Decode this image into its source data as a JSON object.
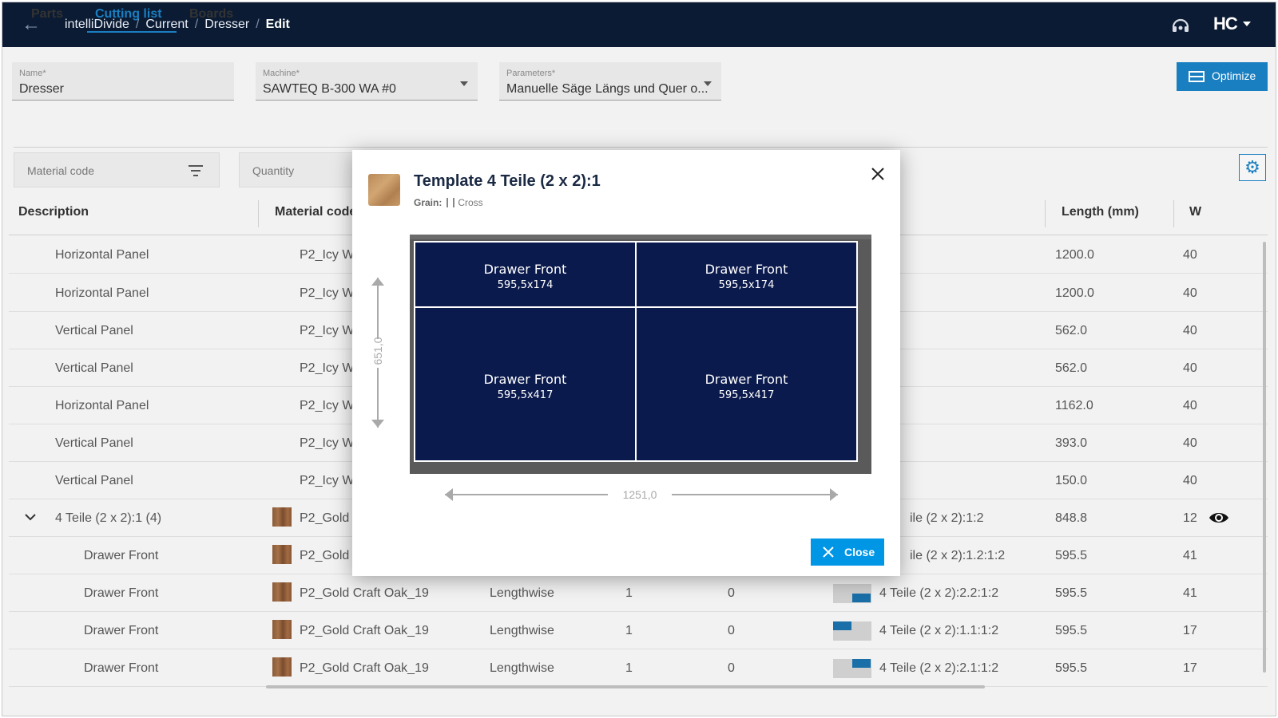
{
  "topbar": {
    "breadcrumbs": [
      "intelliDivide",
      "Current",
      "Dresser",
      "Edit"
    ],
    "brand": "HC"
  },
  "form": {
    "name": {
      "label": "Name*",
      "value": "Dresser"
    },
    "machine": {
      "label": "Machine*",
      "value": "SAWTEQ B-300 WA #0"
    },
    "parameters": {
      "label": "Parameters*",
      "value": "Manuelle Säge Längs und Quer o..."
    },
    "optimize_label": "Optimize"
  },
  "tabs": [
    "Parts",
    "Cutting list",
    "Boards"
  ],
  "active_tab": "Cutting list",
  "filters": {
    "material_code": "Material code",
    "quantity": "Quantity"
  },
  "table": {
    "headers": {
      "description": "Description",
      "material_code": "Material code",
      "length": "Length (mm)",
      "w": "W"
    },
    "rows": [
      {
        "description": "Horizontal Panel",
        "material": "P2_Icy W",
        "length": "1200.0",
        "w": "40"
      },
      {
        "description": "Horizontal Panel",
        "material": "P2_Icy W",
        "length": "1200.0",
        "w": "40"
      },
      {
        "description": "Vertical Panel",
        "material": "P2_Icy W",
        "length": "562.0",
        "w": "40"
      },
      {
        "description": "Vertical Panel",
        "material": "P2_Icy W",
        "length": "562.0",
        "w": "40"
      },
      {
        "description": "Horizontal Panel",
        "material": "P2_Icy W",
        "length": "1162.0",
        "w": "40"
      },
      {
        "description": "Vertical Panel",
        "material": "P2_Icy W",
        "length": "393.0",
        "w": "40"
      },
      {
        "description": "Vertical Panel",
        "material": "P2_Icy W",
        "length": "150.0",
        "w": "40"
      },
      {
        "description": "4 Teile (2 x 2):1 (4)",
        "material": "P2_Gold",
        "template": "ile (2 x 2):1:2",
        "length": "848.8",
        "w": "12"
      },
      {
        "description": "Drawer Front",
        "material": "P2_Gold",
        "template": "ile (2 x 2):1.2:1:2",
        "length": "595.5",
        "w": "41"
      },
      {
        "description": "Drawer Front",
        "material": "P2_Gold Craft Oak_19",
        "grain": "Lengthwise",
        "qty": "1",
        "extra": "0",
        "template": "4 Teile (2 x 2):2.2:1:2",
        "length": "595.5",
        "w": "41"
      },
      {
        "description": "Drawer Front",
        "material": "P2_Gold Craft Oak_19",
        "grain": "Lengthwise",
        "qty": "1",
        "extra": "0",
        "template": "4 Teile (2 x 2):1.1:1:2",
        "length": "595.5",
        "w": "17"
      },
      {
        "description": "Drawer Front",
        "material": "P2_Gold Craft Oak_19",
        "grain": "Lengthwise",
        "qty": "1",
        "extra": "0",
        "template": "4 Teile (2 x 2):2.1:1:2",
        "length": "595.5",
        "w": "17"
      }
    ]
  },
  "modal": {
    "title": "Template 4 Teile (2 x 2):1",
    "grain_label": "Grain:",
    "grain_value": "Cross",
    "height_dim": "651,0",
    "width_dim": "1251,0",
    "parts": [
      {
        "name": "Drawer Front",
        "dims": "595,5x174"
      },
      {
        "name": "Drawer Front",
        "dims": "595,5x174"
      },
      {
        "name": "Drawer Front",
        "dims": "595,5x417"
      },
      {
        "name": "Drawer Front",
        "dims": "595,5x417"
      }
    ],
    "close_label": "Close"
  },
  "colors": {
    "topbar": "#0b1b33",
    "accent": "#1a7fc1",
    "part_fill": "#0b1a4d",
    "close_button": "#0096e6"
  }
}
